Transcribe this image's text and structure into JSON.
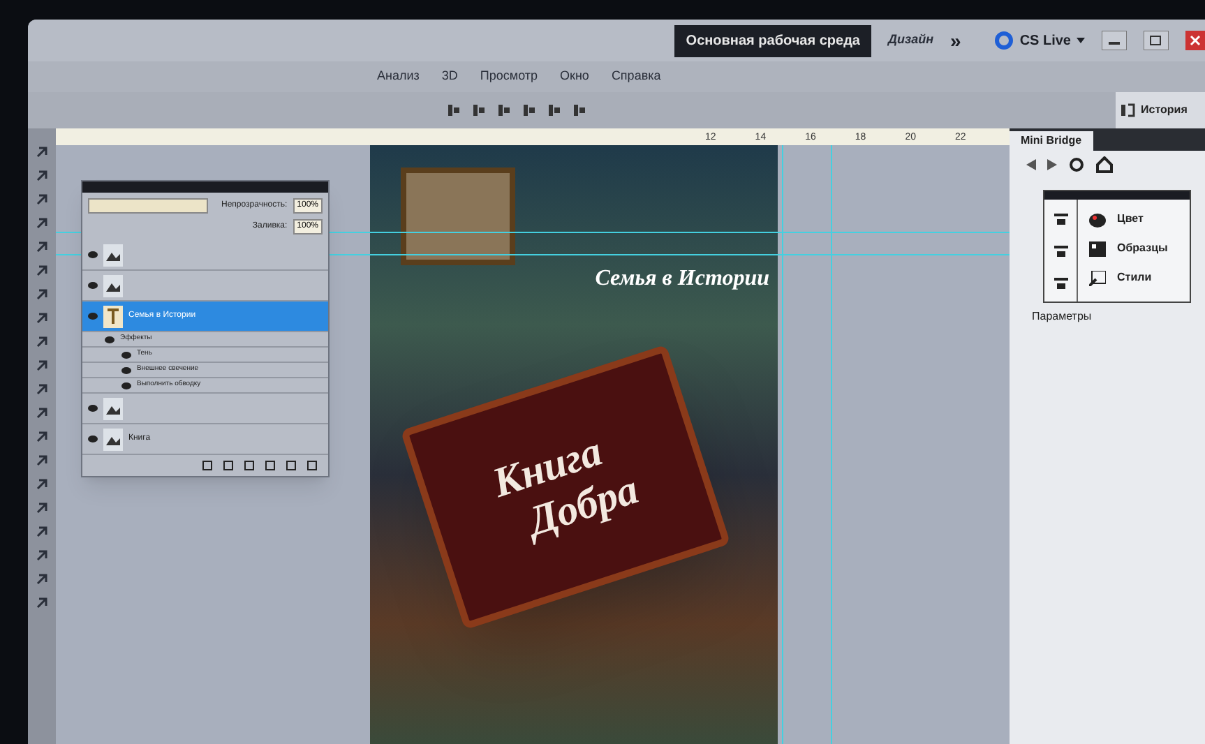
{
  "app_bar": {
    "workspace": "Основная рабочая среда",
    "workspace_alt": "Дизайн",
    "more": "»",
    "cs_live": "CS Live"
  },
  "menu": [
    "Анализ",
    "3D",
    "Просмотр",
    "Окно",
    "Справка"
  ],
  "ruler": [
    "12",
    "14",
    "16",
    "18",
    "20",
    "22"
  ],
  "history_tab": "История",
  "layers_panel": {
    "opacity_label": "Непрозрачность:",
    "opacity": "100%",
    "fill_label": "Заливка:",
    "fill": "100%",
    "layers": [
      {
        "kind": "image",
        "selected": false
      },
      {
        "kind": "image",
        "selected": false
      },
      {
        "kind": "text",
        "name": "Семья в Истории",
        "selected": true,
        "effects": {
          "title": "Эффекты",
          "items": [
            "Тень",
            "Внешнее свечение",
            "Выполнить обводку"
          ]
        }
      },
      {
        "kind": "image",
        "selected": false
      },
      {
        "kind": "image",
        "name": "Книга",
        "selected": false
      }
    ]
  },
  "canvas": {
    "title": "Семья в Истории",
    "book_lines": [
      "Книга",
      "Добра"
    ]
  },
  "right_panel": {
    "tab": "Mini Bridge",
    "items": [
      "Цвет",
      "Образцы",
      "Стили"
    ],
    "label": "Параметры"
  }
}
